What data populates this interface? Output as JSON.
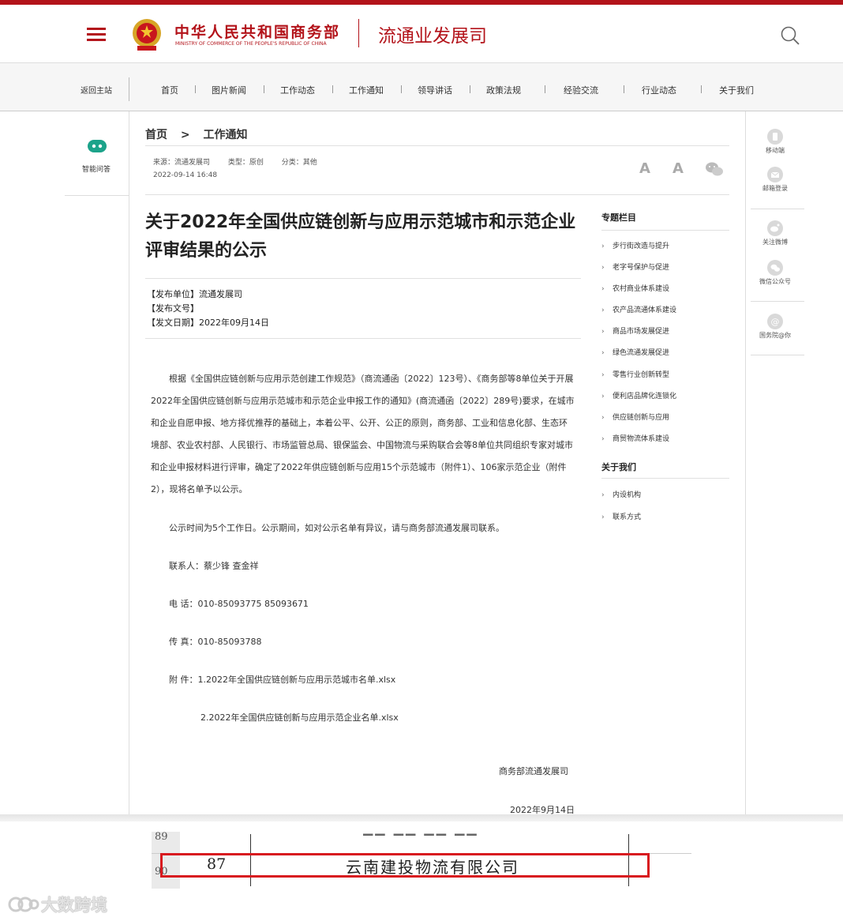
{
  "header": {
    "ministry_cn": "中华人民共和国商务部",
    "ministry_en": "MINISTRY OF COMMERCE OF THE PEOPLE'S REPUBLIC OF CHINA",
    "dept_name": "流通业发展司"
  },
  "nav": {
    "back": "返回主站",
    "items": [
      "首页",
      "图片新闻",
      "工作动态",
      "工作通知",
      "领导讲话",
      "政策法规",
      "经验交流",
      "行业动态",
      "关于我们"
    ]
  },
  "left_rail": {
    "robot_label": "智能问答"
  },
  "right_rail": {
    "mobile": "移动端",
    "mail": "邮箱登录",
    "weibo": "关注微博",
    "wechat": "微信公众号",
    "gov": "国务院@你"
  },
  "breadcrumb": {
    "home": "首页",
    "sep": ">",
    "current": "工作通知"
  },
  "meta": {
    "source": "来源：流通发展司",
    "type": "类型：原创",
    "category": "分类：其他",
    "date": "2022-09-14 16:48",
    "font_large": "A",
    "font_small": "A"
  },
  "article": {
    "title": "关于2022年全国供应链创新与应用示范城市和示范企业评审结果的公示",
    "pub_unit": "【发布单位】流通发展司",
    "pub_no": "【发布文号】",
    "pub_date": "【发文日期】2022年09月14日",
    "para1": "根据《全国供应链创新与应用示范创建工作规范》（商流通函〔2022〕123号）、《商务部等8单位关于开展2022年全国供应链创新与应用示范城市和示范企业申报工作的通知》(商流通函〔2022〕289号)要求，在城市和企业自愿申报、地方择优推荐的基础上，本着公平、公开、公正的原则，商务部、工业和信息化部、生态环境部、农业农村部、人民银行、市场监管总局、银保监会、中国物流与采购联合会等8单位共同组织专家对城市和企业申报材料进行评审，确定了2022年供应链创新与应用15个示范城市（附件1）、106家示范企业（附件2），现将名单予以公示。",
    "para2": "公示时间为5个工作日。公示期间，如对公示名单有异议，请与商务部流通发展司联系。",
    "contact": "联系人：蔡少锋 查金祥",
    "phone": "电 话：010-85093775 85093671",
    "fax": "传 真：010-85093788",
    "attach1": "附 件：1.2022年全国供应链创新与应用示范城市名单.xlsx",
    "attach2": "2.2022年全国供应链创新与应用示范企业名单.xlsx",
    "sign_dept": "商务部流通发展司",
    "sign_date": "2022年9月14日"
  },
  "sidebar": {
    "topics_heading": "专题栏目",
    "topics": [
      "步行街改造与提升",
      "老字号保护与促进",
      "农村商业体系建设",
      "农产品流通体系建设",
      "商品市场发展促进",
      "绿色流通发展促进",
      "零售行业创新转型",
      "便利店品牌化连锁化",
      "供应链创新与应用",
      "商贸物流体系建设"
    ],
    "about_heading": "关于我们",
    "about": [
      "内设机构",
      "联系方式"
    ]
  },
  "excerpt": {
    "row_prev": "89",
    "row_cur": "90",
    "index": "87",
    "company": "云南建投物流有限公司",
    "highlight_color": "#d8191f"
  },
  "watermark": "大数跨境",
  "colors": {
    "brand_red": "#b3131a",
    "robot_green": "#1ca38a"
  }
}
